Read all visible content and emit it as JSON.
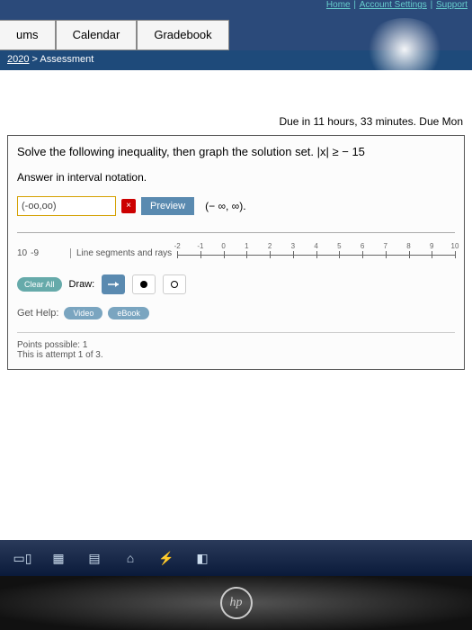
{
  "top_links": {
    "home": "Home",
    "account": "Account Settings",
    "support": "Support"
  },
  "tabs": {
    "forums": "ums",
    "calendar": "Calendar",
    "gradebook": "Gradebook"
  },
  "breadcrumb": {
    "course": "2020",
    "page": "Assessment"
  },
  "due_text": "Due in 11 hours, 33 minutes. Due Mon",
  "question": {
    "prompt": "Solve the following inequality, then graph the solution set. |x| ≥ − 15",
    "instruction": "Answer in interval notation.",
    "input_value": "(-oo,oo)",
    "mark": "×",
    "preview": "Preview",
    "range_display": "(− ∞, ∞)."
  },
  "graph": {
    "left_ticks": [
      "10",
      "-9"
    ],
    "seg_label": "Line segments and rays",
    "ticks": [
      "-2",
      "-1",
      "0",
      "1",
      "2",
      "3",
      "4",
      "5",
      "6",
      "7",
      "8",
      "9",
      "10"
    ]
  },
  "draw": {
    "clear": "Clear All",
    "label": "Draw:"
  },
  "help": {
    "label": "Get Help:",
    "video": "Video",
    "ebook": "eBook"
  },
  "points": {
    "possible": "Points possible: 1",
    "attempt": "This is attempt 1 of 3."
  },
  "logo": "hp"
}
